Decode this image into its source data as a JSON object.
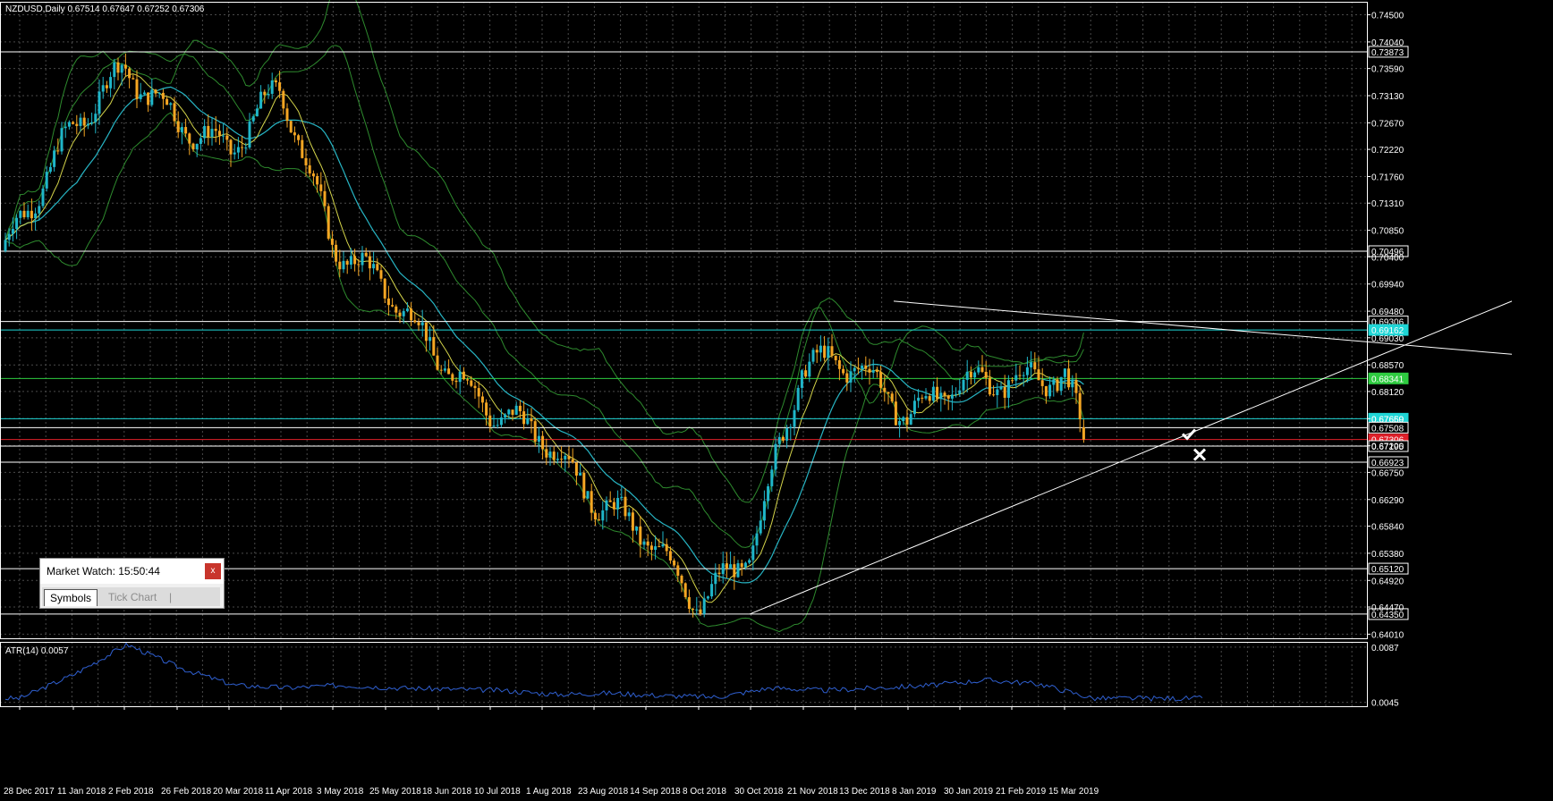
{
  "window": {
    "title": "NZDUSD,Daily  0.67514 0.67647 0.67252 0.67306"
  },
  "indicator": {
    "label": "ATR(14) 0.0057"
  },
  "market_watch": {
    "title": "Market Watch: 15:50:44",
    "close_label": "x",
    "tabs": [
      "Symbols",
      "Tick Chart"
    ],
    "separator": "|"
  },
  "colors": {
    "background": "#000000",
    "grid": "#4a4a4a",
    "bull_candle": "#1fb6c9",
    "bear_candle": "#f5a623",
    "bollinger": "#2e8b2e",
    "ma_fast": "#d4d44a",
    "ma_slow": "#27b5c4",
    "atr": "#2f5fd0",
    "trendline": "#ffffff",
    "level_green": "#2ecc40",
    "level_cyan": "#1fd6d6",
    "level_red": "#e0202a",
    "level_white": "#ffffff"
  },
  "chart_data": [
    {
      "type": "candlestick",
      "title": "NZDUSD,Daily",
      "ohlc_current": {
        "open": 0.67514,
        "high": 0.67647,
        "low": 0.67252,
        "close": 0.67306
      },
      "x_tick_labels": [
        "28 Dec 2017",
        "11 Jan 2018",
        "2 Feb 2018",
        "26 Feb 2018",
        "20 Mar 2018",
        "11 Apr 2018",
        "3 May 2018",
        "25 May 2018",
        "18 Jun 2018",
        "10 Jul 2018",
        "1 Aug 2018",
        "23 Aug 2018",
        "14 Sep 2018",
        "8 Oct 2018",
        "30 Oct 2018",
        "21 Nov 2018",
        "13 Dec 2018",
        "8 Jan 2019",
        "30 Jan 2019",
        "21 Feb 2019",
        "15 Mar 2019"
      ],
      "y_tick_labels": [
        "0.74500",
        "0.74040",
        "0.73590",
        "0.73130",
        "0.72670",
        "0.72220",
        "0.71760",
        "0.71310",
        "0.70850",
        "0.70400",
        "0.69940",
        "0.69480",
        "0.69030",
        "0.68570",
        "0.68120",
        "0.67660",
        "0.67200",
        "0.66750",
        "0.66290",
        "0.65840",
        "0.65380",
        "0.64920",
        "0.64470",
        "0.64010"
      ],
      "ylim": [
        0.6394,
        0.7472
      ],
      "grid": true,
      "highlighted_levels": [
        {
          "price": 0.73873,
          "label": "0.73873",
          "color": "white"
        },
        {
          "price": 0.70496,
          "label": "0.70496",
          "color": "white"
        },
        {
          "price": 0.69306,
          "label": "0.69306",
          "color": "white"
        },
        {
          "price": 0.69162,
          "label": "0.69162",
          "color": "cyan"
        },
        {
          "price": 0.68341,
          "label": "0.68341",
          "color": "green"
        },
        {
          "price": 0.67659,
          "label": "0.67659",
          "color": "cyan"
        },
        {
          "price": 0.67508,
          "label": "0.67508",
          "color": "white"
        },
        {
          "price": 0.67306,
          "label": "0.67306",
          "color": "red"
        },
        {
          "price": 0.67195,
          "label": "0.67195",
          "color": "white"
        },
        {
          "price": 0.66923,
          "label": "0.66923",
          "color": "white"
        },
        {
          "price": 0.6512,
          "label": "0.65120",
          "color": "white"
        },
        {
          "price": 0.6435,
          "label": "0.64350",
          "color": "white"
        }
      ],
      "trendlines": [
        {
          "name": "descending resistance",
          "from": {
            "date": "21 Nov 2018",
            "price": 0.6965
          },
          "to": {
            "date": "after 15 Mar 2019",
            "price": 0.6875
          }
        },
        {
          "name": "ascending support",
          "from": {
            "date": "8 Oct 2018",
            "price": 0.6435
          },
          "to": {
            "date": "after 15 Mar 2019",
            "price": 0.6965
          }
        }
      ],
      "price_path": [
        {
          "date": "28 Dec 2017",
          "price": 0.705
        },
        {
          "date": "11 Jan 2018",
          "price": 0.726
        },
        {
          "date": "2 Feb 2018",
          "price": 0.736
        },
        {
          "date": "26 Feb 2018",
          "price": 0.727
        },
        {
          "date": "20 Mar 2018",
          "price": 0.722
        },
        {
          "date": "11 Apr 2018",
          "price": 0.733
        },
        {
          "date": "3 May 2018",
          "price": 0.706
        },
        {
          "date": "25 May 2018",
          "price": 0.699
        },
        {
          "date": "18 Jun 2018",
          "price": 0.687
        },
        {
          "date": "10 Jul 2018",
          "price": 0.678
        },
        {
          "date": "1 Aug 2018",
          "price": 0.674
        },
        {
          "date": "23 Aug 2018",
          "price": 0.663
        },
        {
          "date": "14 Sep 2018",
          "price": 0.657
        },
        {
          "date": "8 Oct 2018",
          "price": 0.645
        },
        {
          "date": "30 Oct 2018",
          "price": 0.654
        },
        {
          "date": "21 Nov 2018",
          "price": 0.686
        },
        {
          "date": "13 Dec 2018",
          "price": 0.686
        },
        {
          "date": "8 Jan 2019",
          "price": 0.677
        },
        {
          "date": "30 Jan 2019",
          "price": 0.683
        },
        {
          "date": "21 Feb 2019",
          "price": 0.683
        },
        {
          "date": "15 Mar 2019",
          "price": 0.684
        },
        {
          "date": "last",
          "price": 0.67306
        }
      ]
    },
    {
      "type": "line",
      "title": "ATR(14) 0.0057",
      "y_tick_labels": [
        "0.0087",
        "0.0045"
      ],
      "ylim": [
        0.0042,
        0.0091
      ],
      "grid": true,
      "series": [
        {
          "name": "ATR(14)",
          "x_labels": [
            "28 Dec 2017",
            "11 Jan 2018",
            "2 Feb 2018",
            "26 Feb 2018",
            "20 Mar 2018",
            "11 Apr 2018",
            "3 May 2018",
            "25 May 2018",
            "18 Jun 2018",
            "10 Jul 2018",
            "1 Aug 2018",
            "23 Aug 2018",
            "14 Sep 2018",
            "8 Oct 2018",
            "30 Oct 2018",
            "21 Nov 2018",
            "13 Dec 2018",
            "8 Jan 2019",
            "30 Jan 2019",
            "21 Feb 2019",
            "15 Mar 2019"
          ],
          "values": [
            0.0048,
            0.0066,
            0.0089,
            0.0071,
            0.0058,
            0.0056,
            0.0058,
            0.0056,
            0.0055,
            0.0054,
            0.0051,
            0.0052,
            0.005,
            0.0049,
            0.0056,
            0.0054,
            0.0056,
            0.0058,
            0.0062,
            0.0059,
            0.0048
          ]
        }
      ],
      "current_value": 0.0057
    }
  ]
}
